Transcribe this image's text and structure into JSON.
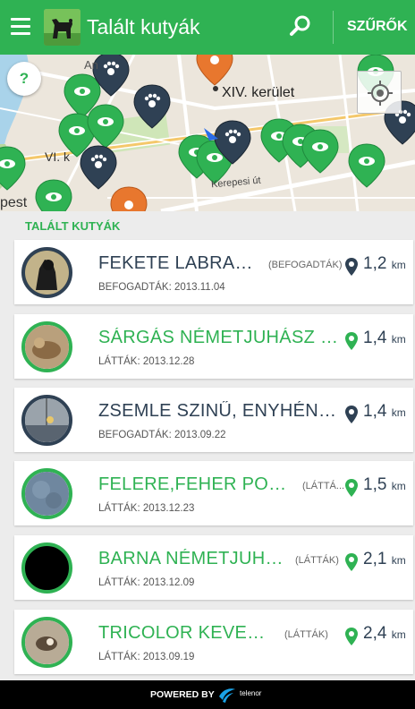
{
  "header": {
    "title": "Talált kutyák",
    "filter_label": "SZŰRŐK",
    "brand_color": "#2fb253"
  },
  "map": {
    "help_label": "?",
    "district_label": "XIV. kerület",
    "street_label": "Kerepesi út",
    "area_label_vi": "VI. k",
    "area_label_pest": "pest",
    "area_label_an": "An"
  },
  "list": {
    "section_title": "TALÁLT KUTYÁK",
    "items": [
      {
        "name": "FEKETE LABRADOR",
        "status": "(BEFOGADTÁK)",
        "date": "BEFOGADTÁK: 2013.11.04",
        "distance": "1,2",
        "unit": "km",
        "kind": "adopted",
        "avatar_color": "#2e3a2a"
      },
      {
        "name": "SÁRGÁS NÉMETJUHÁSZ (KE...",
        "status": "",
        "date": "LÁTTÁK: 2013.12.28",
        "distance": "1,4",
        "unit": "km",
        "kind": "seen",
        "avatar_color": "#9c7f5f"
      },
      {
        "name": "ZSEMLE SZINŰ,  ENYHÉN F...",
        "status": "",
        "date": "BEFOGADTÁK: 2013.09.22",
        "distance": "1,4",
        "unit": "km",
        "kind": "adopted",
        "avatar_color": "#6d7985"
      },
      {
        "name": "FELERE,FEHER POINT...",
        "status": "(LÁTTÁ...",
        "date": "LÁTTÁK: 2013.12.23",
        "distance": "1,5",
        "unit": "km",
        "kind": "seen",
        "avatar_color": "#6f879f"
      },
      {
        "name": "BARNA NÉMETJUHÁSZ",
        "status": "(LÁTTÁK)",
        "date": "LÁTTÁK: 2013.12.09",
        "distance": "2,1",
        "unit": "km",
        "kind": "seen",
        "avatar_color": "#000000"
      },
      {
        "name": "TRICOLOR KEVERÉK",
        "status": "(LÁTTÁK)",
        "date": "LÁTTÁK: 2013.09.19",
        "distance": "2,4",
        "unit": "km",
        "kind": "seen",
        "avatar_color": "#8a7a65"
      }
    ]
  },
  "footer": {
    "powered_by": "POWERED BY",
    "brand": "telenor"
  }
}
